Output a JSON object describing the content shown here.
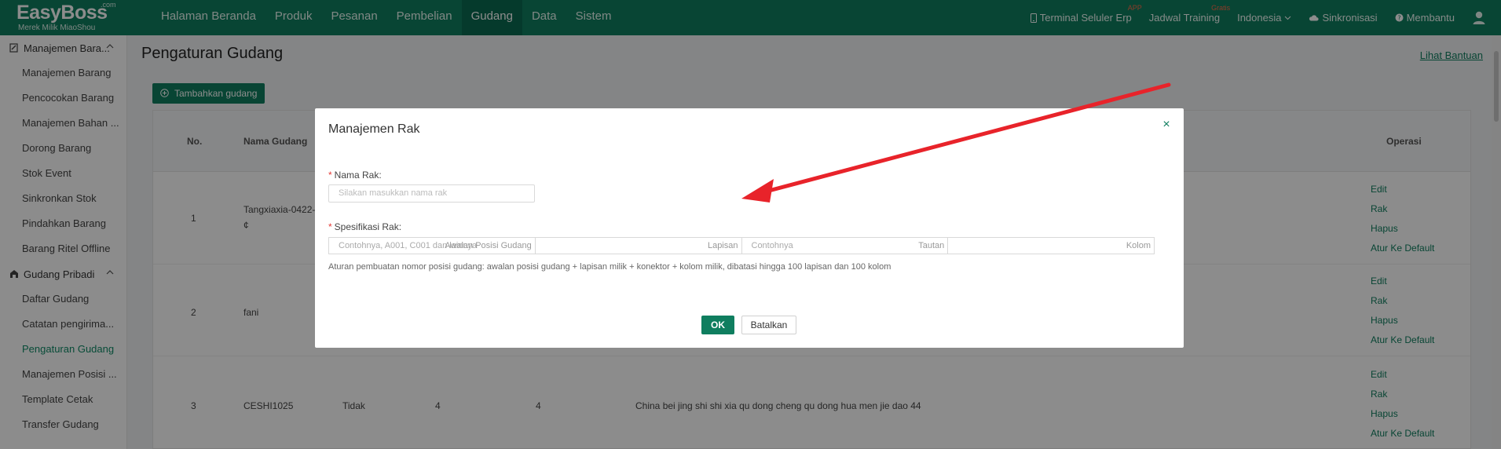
{
  "brand": {
    "name": "EasyBoss",
    "com": ".com",
    "subtitle": "Merek Milik MiaoShou"
  },
  "nav": {
    "items": [
      "Halaman Beranda",
      "Produk",
      "Pesanan",
      "Pembelian",
      "Gudang",
      "Data",
      "Sistem"
    ],
    "active": "Gudang"
  },
  "nav_right": {
    "terminal": "Terminal Seluler Erp",
    "terminal_badge": "APP",
    "training": "Jadwal Training",
    "training_badge": "Gratis",
    "language": "Indonesia",
    "sync": "Sinkronisasi",
    "help": "Membantu"
  },
  "sidebar": {
    "group1": "Manajemen Bara...",
    "group1_items": [
      "Manajemen Barang",
      "Pencocokan Barang",
      "Manajemen Bahan ...",
      "Dorong Barang",
      "Stok Event",
      "Sinkronkan Stok",
      "Pindahkan Barang",
      "Barang Ritel Offline"
    ],
    "group2": "Gudang Pribadi",
    "group2_items": [
      "Daftar Gudang",
      "Catatan pengirima...",
      "Pengaturan Gudang",
      "Manajemen Posisi ...",
      "Template Cetak",
      "Transfer Gudang"
    ],
    "active": "Pengaturan Gudang"
  },
  "page": {
    "title": "Pengaturan Gudang",
    "help_link": "Lihat Bantuan",
    "add_button": "Tambahkan gudang"
  },
  "table": {
    "headers": {
      "no": "No.",
      "name": "Nama Gudang",
      "ops": "Operasi"
    },
    "rows": [
      {
        "no": "1",
        "name": "Tangxiaxia-0422-#",
        "name2": "¢",
        "col3": "",
        "col4": "",
        "col5": "",
        "address": ""
      },
      {
        "no": "2",
        "name": "fani",
        "name2": "",
        "col3": "",
        "col4": "",
        "col5": "",
        "address": ""
      },
      {
        "no": "3",
        "name": "CESHI1025",
        "name2": "",
        "col3": "Tidak",
        "col4": "4",
        "col5": "4",
        "address": "China bei jing shi shi xia qu dong cheng qu dong hua men jie dao 44"
      }
    ],
    "ops": [
      "Edit",
      "Rak",
      "Hapus",
      "Atur Ke Default"
    ]
  },
  "modal": {
    "title": "Manajemen Rak",
    "close": "×",
    "name_label": "Nama Rak:",
    "name_placeholder": "Silakan masukkan nama rak",
    "spec_label": "Spesifikasi Rak:",
    "spec_cells": [
      {
        "placeholder": "Contohnya, A001, C001 dan lainnya",
        "suffix": "Awalan Posisi Gudang"
      },
      {
        "placeholder": "",
        "suffix": "Lapisan"
      },
      {
        "placeholder": "Contohnya",
        "suffix": "Tautan"
      },
      {
        "placeholder": "",
        "suffix": "Kolom"
      }
    ],
    "hint": "Aturan pembuatan nomor posisi gudang: awalan posisi gudang + lapisan milik + konektor + kolom milik, dibatasi hingga 100 lapisan dan 100 kolom",
    "ok": "OK",
    "cancel": "Batalkan",
    "required_mark": "*"
  },
  "colors": {
    "brand": "#0f7e5f",
    "arrow": "#e8232a",
    "required": "#e53935"
  }
}
